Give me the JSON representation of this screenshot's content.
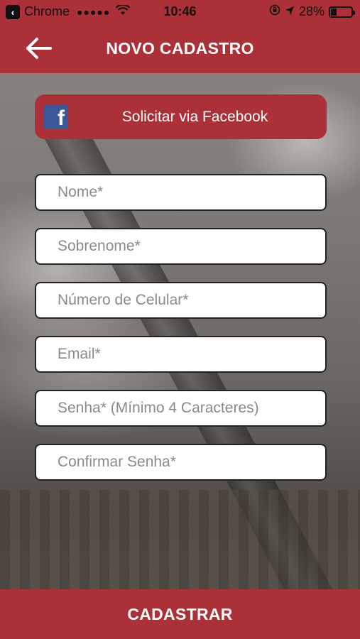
{
  "status_bar": {
    "back_app": "Chrome",
    "signal": "●●●●●",
    "time": "10:46",
    "battery_percent": "28%",
    "battery_level": 0.28
  },
  "header": {
    "title": "NOVO CADASTRO",
    "back_icon": "arrow-left-icon"
  },
  "facebook": {
    "label": "Solicitar via Facebook",
    "icon": "facebook-icon",
    "icon_glyph": "f"
  },
  "form": {
    "fields": [
      {
        "placeholder": "Nome*",
        "value": ""
      },
      {
        "placeholder": "Sobrenome*",
        "value": ""
      },
      {
        "placeholder": "Número de Celular*",
        "value": ""
      },
      {
        "placeholder": "Email*",
        "value": ""
      },
      {
        "placeholder": "Senha* (Mínimo 4 Caracteres)",
        "value": ""
      },
      {
        "placeholder": "Confirmar Senha*",
        "value": ""
      }
    ]
  },
  "submit": {
    "label": "CADASTRAR"
  },
  "colors": {
    "brand_red": "#ac3038",
    "facebook_blue": "#3b5998"
  }
}
